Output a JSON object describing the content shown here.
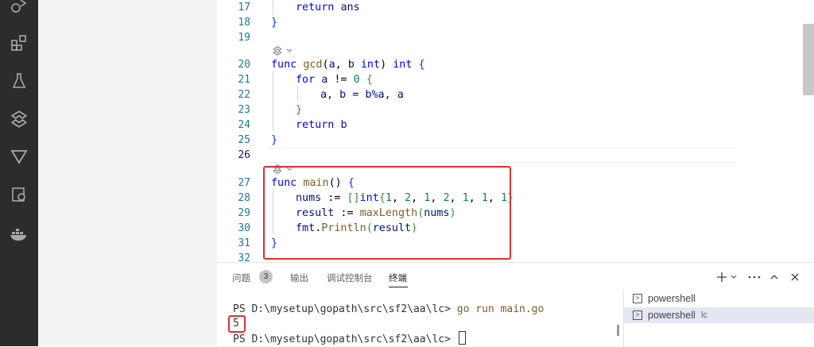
{
  "editor": {
    "lines": [
      {
        "n": "17"
      },
      {
        "n": "18"
      },
      {
        "n": "19"
      },
      {
        "n": "20"
      },
      {
        "n": "21"
      },
      {
        "n": "22"
      },
      {
        "n": "23"
      },
      {
        "n": "24"
      },
      {
        "n": "25"
      },
      {
        "n": "26"
      },
      {
        "n": "27"
      },
      {
        "n": "28"
      },
      {
        "n": "29"
      },
      {
        "n": "30"
      },
      {
        "n": "31"
      },
      {
        "n": "32"
      }
    ],
    "code": {
      "l17_kw": "return",
      "l17_var": "ans",
      "l18": "}",
      "l20_func": "func",
      "l20_name": "gcd",
      "l20_p1": "(",
      "l20_a": "a",
      "l20_comma": ", ",
      "l20_b": "b",
      "l20_int1": "int",
      "l20_p2": ") ",
      "l20_int2": "int",
      "l20_brace": "{",
      "l21_for": "for",
      "l21_a": "a",
      "l21_ne": " != ",
      "l21_zero": "0",
      "l21_brace": "{",
      "l22": "a, b = b%a, a",
      "l23": "}",
      "l24_kw": "return",
      "l24_var": "b",
      "l25": "}",
      "l27_func": "func",
      "l27_name": "main",
      "l27_paren": "() ",
      "l27_brace": "{",
      "l28_var": "nums",
      "l28_op": " := ",
      "l28_br": "[]",
      "l28_type": "int",
      "l28_b1": "{",
      "l28_n1": "1",
      "l28_n2": "2",
      "l28_n3": "1",
      "l28_n4": "2",
      "l28_n5": "1",
      "l28_n6": "1",
      "l28_n7": "1",
      "l28_b2": "}",
      "l28_sep": ", ",
      "l29_var": "result",
      "l29_op": " := ",
      "l29_fn": "maxLength",
      "l29_p1": "(",
      "l29_arg": "nums",
      "l29_p2": ")",
      "l30_pkg": "fmt",
      "l30_dot": ".",
      "l30_fn": "Println",
      "l30_p1": "(",
      "l30_arg": "result",
      "l30_p2": ")",
      "l31": "}"
    }
  },
  "panel": {
    "tabs": {
      "problems": "问题",
      "problems_count": "3",
      "output": "输出",
      "debug_console": "调试控制台",
      "terminal": "终端"
    },
    "terminal": {
      "line1_prompt": "PS D:\\mysetup\\gopath\\src\\sf2\\aa\\lc> ",
      "line1_cmd": "go run main.go",
      "line2_output": "5",
      "line3_prompt": "PS D:\\mysetup\\gopath\\src\\sf2\\aa\\lc> "
    },
    "terminal_list": [
      {
        "label": "powershell",
        "sub": ""
      },
      {
        "label": "powershell",
        "sub": "lc"
      }
    ]
  },
  "colors": {
    "highlight": "#e03030",
    "keyword": "#0000ff",
    "function": "#795e26",
    "number": "#098658"
  }
}
